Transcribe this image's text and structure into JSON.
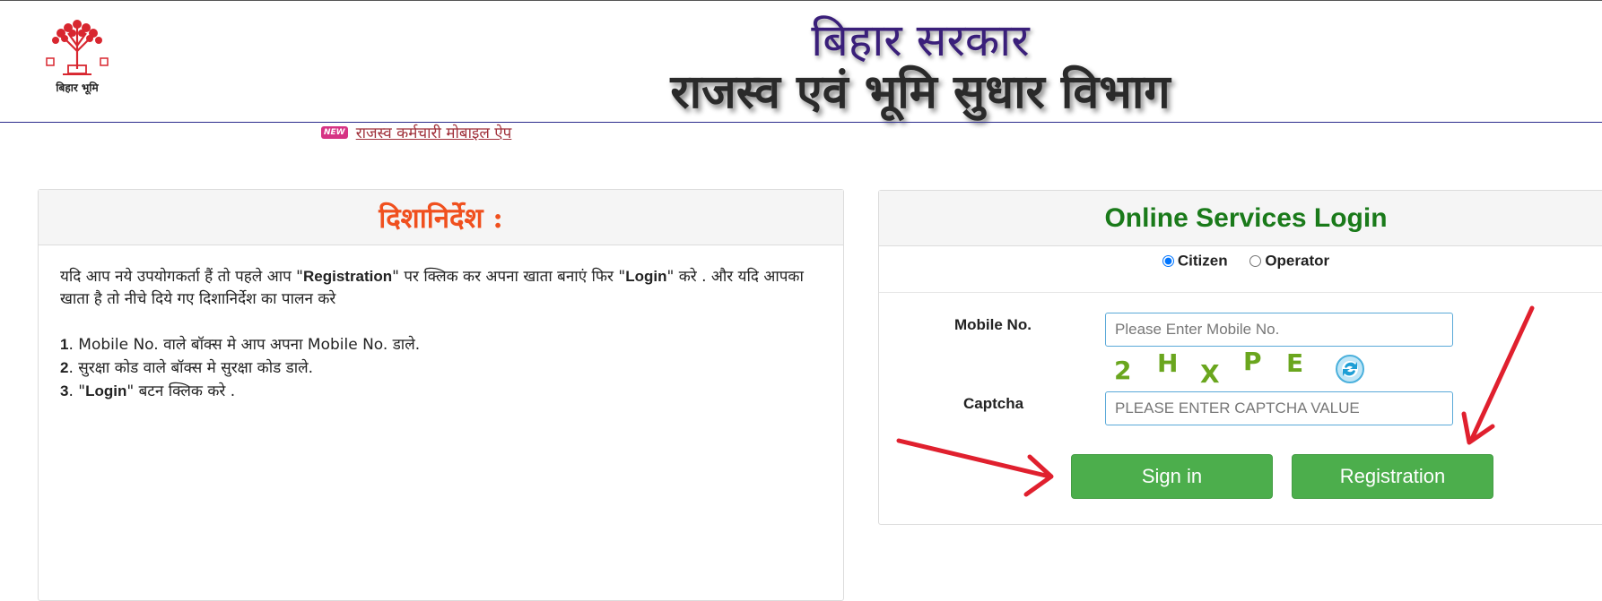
{
  "header": {
    "logo_caption": "बिहार भूमि",
    "title_line1": "बिहार सरकार",
    "title_line2": "राजस्व एवं भूमि सुधार विभाग",
    "new_badge": "NEW",
    "app_link": "राजस्व कर्मचारी मोबाइल ऐप"
  },
  "guidelines": {
    "title": "दिशानिर्देश :",
    "intro_1": "यदि आप नये उपयोगकर्ता हैं तो पहले आप \"",
    "intro_registration": "Registration",
    "intro_2": "\" पर क्लिक कर अपना खाता बनाएं फिर \"",
    "intro_login": "Login",
    "intro_3": "\" करे . और यदि आपका खाता है तो नीचे दिये गए दिशानिर्देश का पालन करे",
    "steps": [
      {
        "num": "1",
        "text": ". Mobile No. वाले बॉक्स मे आप अपना Mobile No. डाले."
      },
      {
        "num": "2",
        "text": ". सुरक्षा कोड वाले बॉक्स मे सुरक्षा कोड डाले."
      },
      {
        "num": "3",
        "text_pre": ". \"",
        "bold": "Login",
        "text_post": "\" बटन क्लिक करे ."
      }
    ]
  },
  "login": {
    "title": "Online Services Login",
    "roles": [
      {
        "label": "Citizen",
        "checked": true
      },
      {
        "label": "Operator",
        "checked": false
      }
    ],
    "mobile_label": "Mobile No.",
    "mobile_placeholder": "Please Enter Mobile No.",
    "mobile_value": "",
    "captcha_label": "Captcha",
    "captcha_text": "2HXPE",
    "captcha_placeholder": "PLEASE ENTER CAPTCHA VALUE",
    "captcha_value": "",
    "signin_label": "Sign in",
    "registration_label": "Registration"
  },
  "colors": {
    "accent_green": "#4cae4c",
    "title_green": "#1a7a1a",
    "guide_orange": "#f0501e",
    "title_purple": "#3a1f7a",
    "arrow_red": "#e0202e"
  },
  "icons": [
    "logo-tree-icon",
    "new-badge-icon",
    "refresh-icon",
    "arrow-icon"
  ]
}
